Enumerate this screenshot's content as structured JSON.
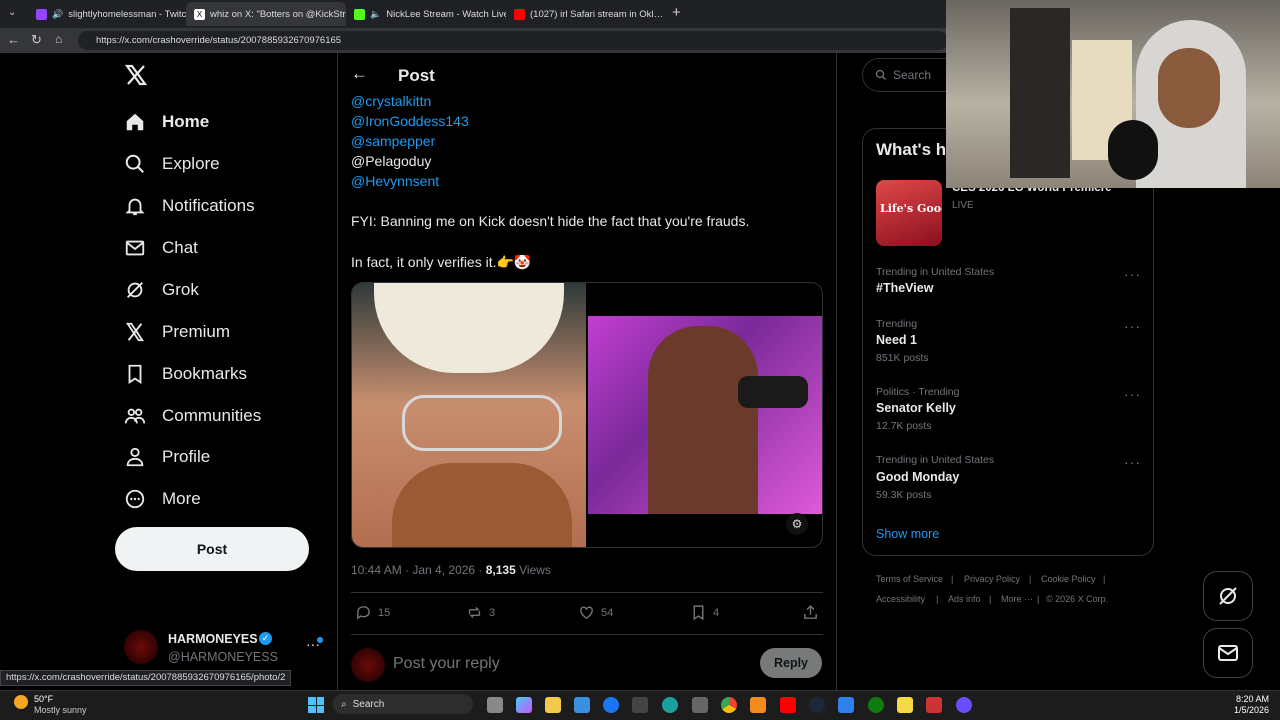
{
  "browser": {
    "tabs": [
      {
        "label": "slightlyhomelessman - Twitch",
        "color": "#9146ff"
      },
      {
        "label": "whiz on X: \"Botters on @KickStrea…",
        "color": "#000000"
      },
      {
        "label": "NickLee Stream - Watch Live o…",
        "color": "#53fc18"
      },
      {
        "label": "(1027) irl Safari stream in Okl…",
        "color": "#ff0000"
      }
    ],
    "url": "https://x.com/crashoverride/status/2007885932670976165",
    "status_url": "https://x.com/crashoverride/status/2007885932670976165/photo/2"
  },
  "nav": {
    "items": [
      {
        "label": "Home",
        "icon": "home-icon"
      },
      {
        "label": "Explore",
        "icon": "search-icon"
      },
      {
        "label": "Notifications",
        "icon": "bell-icon"
      },
      {
        "label": "Chat",
        "icon": "mail-icon"
      },
      {
        "label": "Grok",
        "icon": "grok-icon"
      },
      {
        "label": "Premium",
        "icon": "x-logo-icon"
      },
      {
        "label": "Bookmarks",
        "icon": "bookmark-icon"
      },
      {
        "label": "Communities",
        "icon": "people-icon"
      },
      {
        "label": "Profile",
        "icon": "person-icon"
      },
      {
        "label": "More",
        "icon": "more-circle-icon"
      }
    ],
    "post_button": "Post",
    "account": {
      "name": "HARMONEYES",
      "handle": "@HARMONEYESS"
    }
  },
  "post": {
    "header": "Post",
    "mentions": [
      "@crystalkittn",
      "@IronGoddess143",
      "@sampepper"
    ],
    "plain_handle": "@Pelagoduy",
    "mention_last": "@Hevynnsent",
    "line1": "FYI: Banning me on Kick doesn't hide the fact that you're frauds.",
    "line2": "In fact, it only verifies it.👉🤡",
    "timestamp": "10:44 AM · Jan 4, 2026 · ",
    "views_count": "8,135",
    "views_label": " Views",
    "replies": "15",
    "reposts": "3",
    "likes": "54",
    "bookmarks": "4",
    "reply_placeholder": "Post your reply",
    "reply_button": "Reply"
  },
  "sidebar": {
    "search_placeholder": "Search",
    "whats_happening": "What's h",
    "featured": {
      "title": "CES 2026 LG World Premiere",
      "status": "LIVE",
      "thumb_text": "Life's Good."
    },
    "trends": [
      {
        "context": "Trending in United States",
        "name": "#TheView",
        "posts": ""
      },
      {
        "context": "Trending",
        "name": "Need 1",
        "posts": "851K posts"
      },
      {
        "context": "Politics · Trending",
        "name": "Senator Kelly",
        "posts": "12.7K posts"
      },
      {
        "context": "Trending in United States",
        "name": "Good Monday",
        "posts": "59.3K posts"
      }
    ],
    "show_more": "Show more",
    "footer": [
      "Terms of Service",
      "Privacy Policy",
      "Cookie Policy",
      "Accessibility",
      "Ads info",
      "More ···",
      "© 2026 X Corp."
    ]
  },
  "taskbar": {
    "weather_temp": "50°F",
    "weather_desc": "Mostly sunny",
    "search": "Search",
    "time": "8:20 AM",
    "date": "1/5/2026"
  },
  "colors": {
    "accent": "#1d9bf0",
    "bg": "#000000",
    "border": "#2f3336",
    "muted": "#71767b"
  }
}
